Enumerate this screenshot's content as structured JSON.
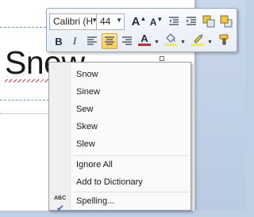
{
  "document": {
    "word": "Snew"
  },
  "mini_toolbar": {
    "font_name": "Calibri (H",
    "font_size": "44",
    "grow_font_icon": "A",
    "shrink_font_icon": "A",
    "bold_label": "B",
    "italic_label": "I",
    "font_color_label": "A",
    "font_color": "#e02020",
    "highlight_color": "#f6ee2a"
  },
  "context_menu": {
    "suggestions": [
      "Snow",
      "Sinew",
      "Sew",
      "Skew",
      "Slew"
    ],
    "ignore_all": "Ignore All",
    "add_to_dictionary": "Add to Dictionary",
    "spelling": "Spelling...",
    "spelling_icon_text": "ABC"
  }
}
